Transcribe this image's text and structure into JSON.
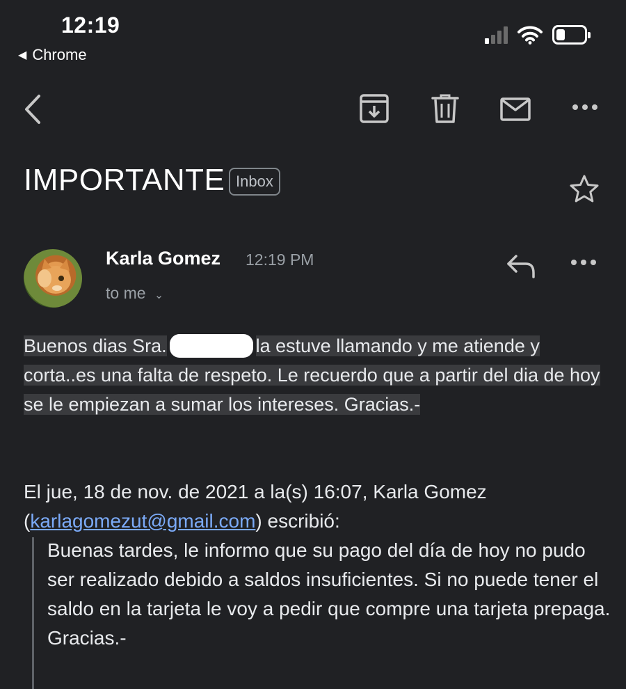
{
  "status_bar": {
    "time": "12:19",
    "back_app": "Chrome"
  },
  "toolbar": {
    "back_icon": "chevron-left-icon",
    "archive_icon": "archive-icon",
    "delete_icon": "trash-icon",
    "mark_unread_icon": "mail-icon",
    "more_icon": "more-horizontal-icon"
  },
  "email": {
    "subject": "IMPORTANTE",
    "label": "Inbox",
    "sender_name": "Karla Gomez",
    "time": "12:19 PM",
    "recipient": "to me",
    "body_part1": "Buenos dias Sra.",
    "body_part2": "la estuve llamando y me atiende y corta..es una falta de respeto. Le recuerdo que a partir del dia de hoy se le empiezan a sumar los intereses. Gracias.-",
    "quote_header_pre": "El jue, 18 de nov. de 2021 a la(s) 16:07, Karla Gomez (",
    "quote_email": "karlagomezut@gmail.com",
    "quote_header_post": ") escribió:",
    "quoted_body": "Buenas tardes, le informo que su pago del día de hoy no pudo ser realizado debido a saldos insuficientes. Si no puede tener el saldo en la tarjeta le voy a pedir que compre una tarjeta prepaga. Gracias.-"
  },
  "colors": {
    "background": "#202124",
    "link": "#7baaf7",
    "muted": "#9aa0a6"
  }
}
